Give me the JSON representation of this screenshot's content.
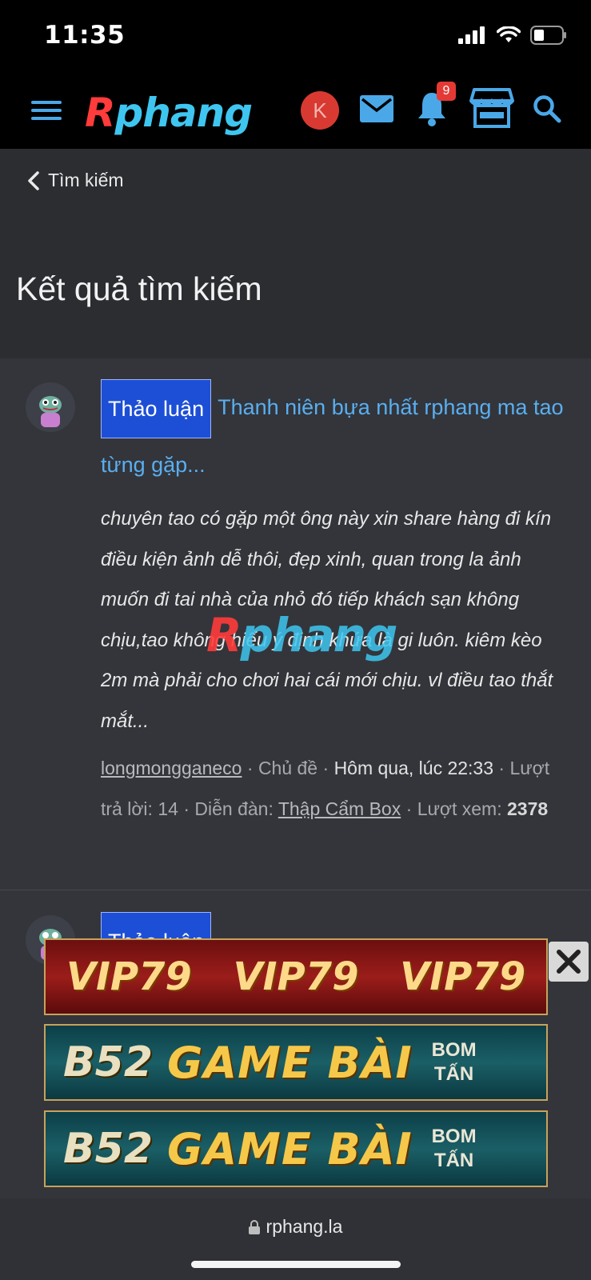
{
  "status": {
    "time": "11:35"
  },
  "header": {
    "logo": "Rphang",
    "logo_first": "R",
    "logo_rest": "phang",
    "avatar_initial": "K",
    "notifications_count": "9"
  },
  "breadcrumb": {
    "label": "Tìm kiếm"
  },
  "page": {
    "title": "Kết quả tìm kiếm"
  },
  "results": [
    {
      "label": "Thảo luận",
      "title": "Thanh niên bựa nhất rphang ma tao từng gặp...",
      "snippet": "chuyên tao có gặp một ông này xin share hàng đi kín điều kiện ảnh dễ thôi, đẹp xinh, quan trong la ảnh muốn đi tai nhà của nhỏ đó tiếp khách sạn không chịu,tao không hiểu ý định khứa là gi luôn. kiêm kèo 2m mà phải cho chơi hai cái mới chịu. vl điều tao thắt mắt...",
      "author": "longmongganeco",
      "type": "Chủ đề",
      "time": "Hôm qua, lúc 22:33",
      "replies_label": "Lượt trả lời:",
      "replies": "14",
      "forum_label": "Diễn đàn:",
      "forum": "Thập Cẩm Box",
      "views_label": "Lượt xem:",
      "views": "2378"
    },
    {
      "label": "Thảo luận"
    }
  ],
  "watermark": "Rphang",
  "ads": {
    "vip": [
      "VIP79",
      "VIP79",
      "VIP79"
    ],
    "b52": {
      "brand": "B52",
      "text": "GAME BÀI",
      "tag_line1": "BOM",
      "tag_line2": "TẤN"
    }
  },
  "browser": {
    "url": "rphang.la"
  },
  "icons": [
    "menu-icon",
    "mail-icon",
    "bell-icon",
    "store-icon",
    "search-icon",
    "chevron-left-icon",
    "lock-icon",
    "close-icon"
  ]
}
